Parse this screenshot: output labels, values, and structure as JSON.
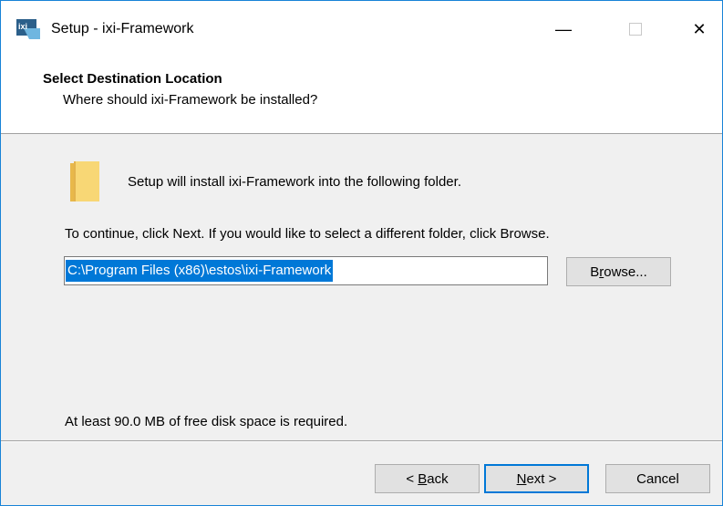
{
  "window": {
    "title": "Setup - ixi-Framework",
    "app_icon_text": "ixi",
    "minimize_glyph": "—",
    "close_glyph": "✕",
    "icons": {
      "app": "ixi-app-icon",
      "minimize": "minimize-icon",
      "maximize": "maximize-icon",
      "close": "close-icon"
    }
  },
  "header": {
    "title": "Select Destination Location",
    "subtitle": "Where should ixi-Framework be installed?"
  },
  "body": {
    "folder_icon": "folder-icon",
    "info": "Setup will install ixi-Framework into the following folder.",
    "instruction": "To continue, click Next. If you would like to select a different folder, click Browse.",
    "path_value": "C:\\Program Files (x86)\\estos\\ixi-Framework",
    "browse": {
      "before": "B",
      "accel": "r",
      "after": "owse..."
    },
    "disk_space": "At least 90.0 MB of free disk space is required."
  },
  "footer": {
    "back": {
      "prefix": "< ",
      "accel": "B",
      "after": "ack"
    },
    "next": {
      "accel": "N",
      "after": "ext >"
    },
    "cancel": "Cancel"
  },
  "colors": {
    "accent": "#0078d7",
    "window_border": "#1883d7",
    "folder": "#f8d775"
  }
}
